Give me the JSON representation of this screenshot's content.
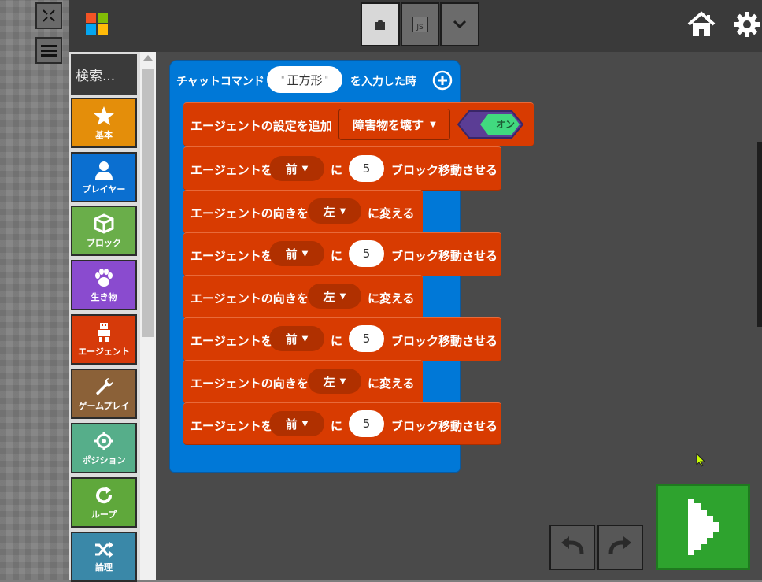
{
  "sidebar": {
    "search_placeholder": "検索...",
    "categories": [
      {
        "label": "基本",
        "color": "#e48e0a"
      },
      {
        "label": "プレイヤー",
        "color": "#0b6fd0"
      },
      {
        "label": "ブロック",
        "color": "#6aae4a"
      },
      {
        "label": "生き物",
        "color": "#8a4bcf"
      },
      {
        "label": "エージェント",
        "color": "#d63a0a"
      },
      {
        "label": "ゲームプレイ",
        "color": "#8b6138"
      },
      {
        "label": "ポジション",
        "color": "#56ae8a"
      },
      {
        "label": "ループ",
        "color": "#5fa83b"
      },
      {
        "label": "論理",
        "color": "#3a88a8"
      }
    ]
  },
  "toolbar": {
    "js_label": "JS"
  },
  "workspace": {
    "hat": {
      "prefix": "チャットコマンド",
      "command": "正方形",
      "suffix": "を入力した時"
    },
    "blocks": [
      {
        "type": "setting",
        "label": "エージェントの設定を追加",
        "option": "障害物を壊す",
        "toggle": "オン"
      },
      {
        "type": "move",
        "label": "エージェントを",
        "direction": "前",
        "ni": "に",
        "count": "5",
        "suffix": "ブロック移動させる"
      },
      {
        "type": "turn",
        "label": "エージェントの向きを",
        "direction": "左",
        "suffix": "に変える"
      },
      {
        "type": "move",
        "label": "エージェントを",
        "direction": "前",
        "ni": "に",
        "count": "5",
        "suffix": "ブロック移動させる"
      },
      {
        "type": "turn",
        "label": "エージェントの向きを",
        "direction": "左",
        "suffix": "に変える"
      },
      {
        "type": "move",
        "label": "エージェントを",
        "direction": "前",
        "ni": "に",
        "count": "5",
        "suffix": "ブロック移動させる"
      },
      {
        "type": "turn",
        "label": "エージェントの向きを",
        "direction": "左",
        "suffix": "に変える"
      },
      {
        "type": "move",
        "label": "エージェントを",
        "direction": "前",
        "ni": "に",
        "count": "5",
        "suffix": "ブロック移動させる"
      }
    ]
  },
  "colors": {
    "agent_block": "#d83b01",
    "event_block": "#0078d7",
    "run_button": "#2ea32e"
  }
}
